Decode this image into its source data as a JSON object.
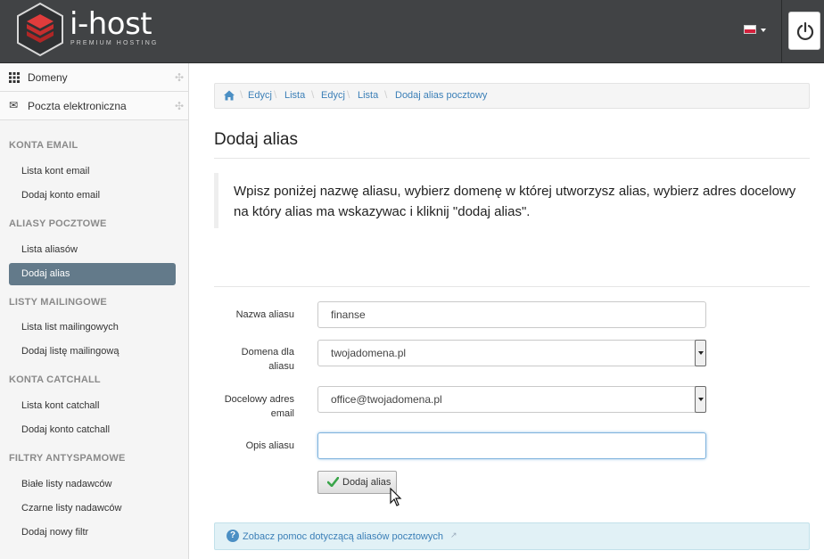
{
  "header": {
    "brand": "i-host",
    "tagline": "PREMIUM HOSTING",
    "language": "pl-flag"
  },
  "sidebar": {
    "top_items": [
      {
        "label": "Domeny",
        "icon": "grid-icon"
      },
      {
        "label": "Poczta elektroniczna",
        "icon": "envelope-icon"
      }
    ],
    "sections": [
      {
        "title": "KONTA EMAIL",
        "items": [
          "Lista kont email",
          "Dodaj konto email"
        ]
      },
      {
        "title": "ALIASY POCZTOWE",
        "items": [
          "Lista aliasów",
          "Dodaj alias"
        ]
      },
      {
        "title": "LISTY MAILINGOWE",
        "items": [
          "Lista list mailingowych",
          "Dodaj listę mailingową"
        ]
      },
      {
        "title": "KONTA CATCHALL",
        "items": [
          "Lista kont catchall",
          "Dodaj konto catchall"
        ]
      },
      {
        "title": "FILTRY ANTYSPAMOWE",
        "items": [
          "Białe listy nadawców",
          "Czarne listy nadawców",
          "Dodaj nowy filtr"
        ]
      }
    ],
    "active_item": "Dodaj alias"
  },
  "breadcrumb": [
    "Edycj",
    "Lista",
    "Edycj",
    "Lista",
    "Dodaj alias pocztowy"
  ],
  "page": {
    "title": "Dodaj alias",
    "intro": "Wpisz poniżej nazwę aliasu, wybierz domenę w której utworzysz alias, wybierz adres docelowy na który alias ma wskazywac i kliknij \"dodaj alias\"."
  },
  "form": {
    "alias_name_label": "Nazwa aliasu",
    "alias_name_value": "finanse",
    "domain_label": "Domena dla aliasu",
    "domain_value": "twojadomena.pl",
    "target_label": "Docelowy adres email",
    "target_value": "office@twojadomena.pl",
    "description_label": "Opis aliasu",
    "description_value": "",
    "submit_label": "Dodaj alias"
  },
  "help": {
    "link": "Zobacz pomoc dotyczącą aliasów pocztowych"
  },
  "colors": {
    "header_bg": "#414345",
    "active_nav": "#637a8a",
    "link": "#3b7fb7",
    "help_bg": "#e1f1f6"
  }
}
